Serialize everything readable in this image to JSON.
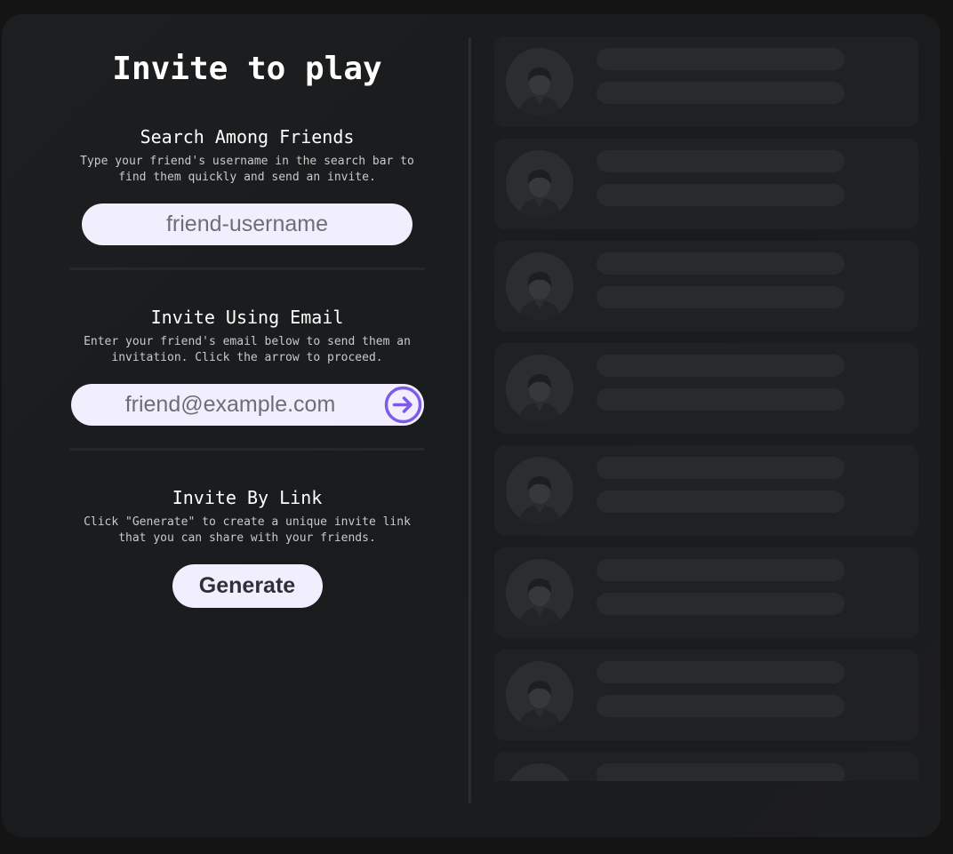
{
  "title": "Invite to play",
  "search_section": {
    "heading": "Search Among Friends",
    "description": "Type your friend's username in the search bar to find them quickly and send an invite.",
    "input_placeholder": "friend-username"
  },
  "email_section": {
    "heading": "Invite Using Email",
    "description": "Enter your friend's email below to send them an invitation. Click the arrow to proceed.",
    "input_placeholder": "friend@example.com",
    "submit_icon": "arrow-right-circle-icon"
  },
  "link_section": {
    "heading": "Invite By Link",
    "description": "Click \"Generate\" to create a unique invite link that you can share with your friends.",
    "button_label": "Generate"
  },
  "friends_list": {
    "state": "loading-skeleton",
    "avatar_icon": "user-avatar-placeholder-icon",
    "visible_rows": 8
  },
  "colors": {
    "accent": "#7c5ce6",
    "input_background": "#f1effd",
    "card_background": "#1b1d1f",
    "skeleton": "#282a2c"
  }
}
